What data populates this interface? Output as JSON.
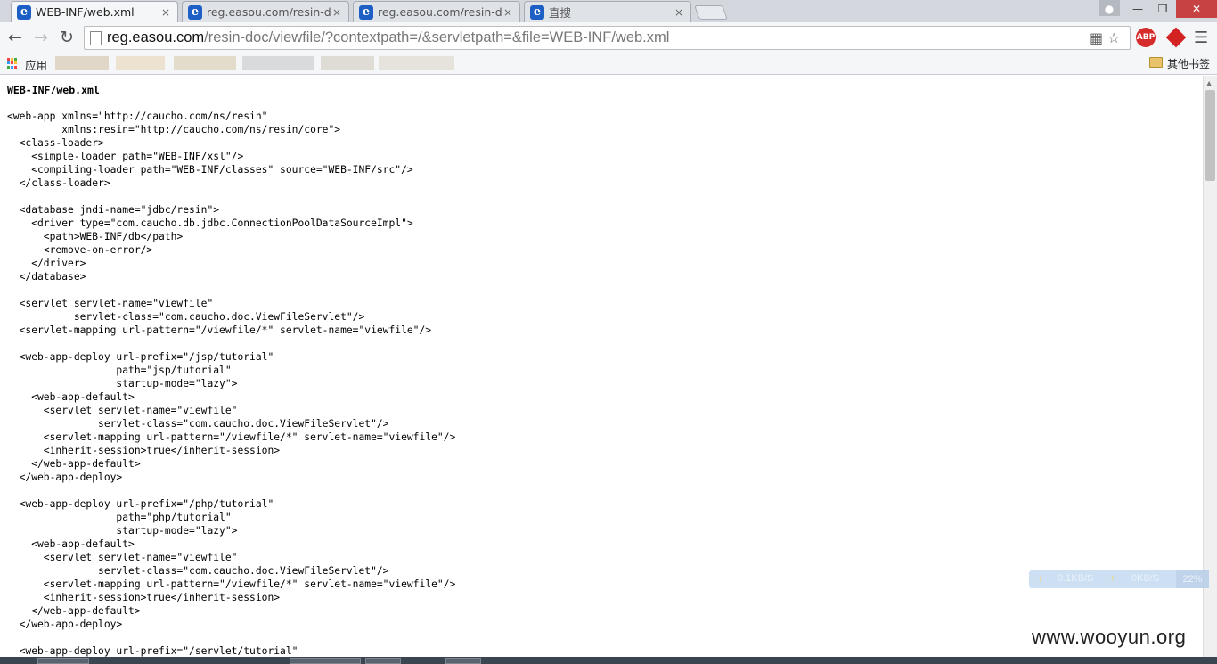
{
  "tabs": [
    {
      "title": "WEB-INF/web.xml",
      "icon": "ie-icon",
      "active": true
    },
    {
      "title": "reg.easou.com/resin-do",
      "icon": "ie-icon",
      "active": false
    },
    {
      "title": "reg.easou.com/resin-do",
      "icon": "ie-icon",
      "active": false
    },
    {
      "title": "直搜",
      "icon": "ie-icon",
      "active": false
    }
  ],
  "tab_close_glyph": "×",
  "toolbar": {
    "url_host": "reg.easou.com",
    "url_rest": "/resin-doc/viewfile/?contextpath=/&servletpath=&file=WEB-INF/web.xml",
    "abp_label": "ABP"
  },
  "bookmarks": {
    "apps_label": "应用",
    "other_label": "其他书签"
  },
  "page": {
    "heading": "WEB-INF/web.xml",
    "code": "<web-app xmlns=\"http://caucho.com/ns/resin\"\n         xmlns:resin=\"http://caucho.com/ns/resin/core\">\n  <class-loader>\n    <simple-loader path=\"WEB-INF/xsl\"/>\n    <compiling-loader path=\"WEB-INF/classes\" source=\"WEB-INF/src\"/>\n  </class-loader>\n\n  <database jndi-name=\"jdbc/resin\">\n    <driver type=\"com.caucho.db.jdbc.ConnectionPoolDataSourceImpl\">\n      <path>WEB-INF/db</path>\n      <remove-on-error/>\n    </driver>\n  </database>\n\n  <servlet servlet-name=\"viewfile\"\n           servlet-class=\"com.caucho.doc.ViewFileServlet\"/>\n  <servlet-mapping url-pattern=\"/viewfile/*\" servlet-name=\"viewfile\"/>\n\n  <web-app-deploy url-prefix=\"/jsp/tutorial\"\n                  path=\"jsp/tutorial\"\n                  startup-mode=\"lazy\">\n    <web-app-default>\n      <servlet servlet-name=\"viewfile\"\n               servlet-class=\"com.caucho.doc.ViewFileServlet\"/>\n      <servlet-mapping url-pattern=\"/viewfile/*\" servlet-name=\"viewfile\"/>\n      <inherit-session>true</inherit-session>\n    </web-app-default>\n  </web-app-deploy>\n\n  <web-app-deploy url-prefix=\"/php/tutorial\"\n                  path=\"php/tutorial\"\n                  startup-mode=\"lazy\">\n    <web-app-default>\n      <servlet servlet-name=\"viewfile\"\n               servlet-class=\"com.caucho.doc.ViewFileServlet\"/>\n      <servlet-mapping url-pattern=\"/viewfile/*\" servlet-name=\"viewfile\"/>\n      <inherit-session>true</inherit-session>\n    </web-app-default>\n  </web-app-deploy>\n\n  <web-app-deploy url-prefix=\"/servlet/tutorial\""
  },
  "net_monitor": {
    "down_speed": "0.1KB/S",
    "up_speed": "0KB/S",
    "cpu": "22%"
  },
  "watermark": "www.wooyun.org",
  "colors": {
    "active_tab": "#f5f6f7",
    "ie_blue": "#1e5fc5",
    "abp_red": "#d62b2b",
    "close_red": "#c74343"
  }
}
